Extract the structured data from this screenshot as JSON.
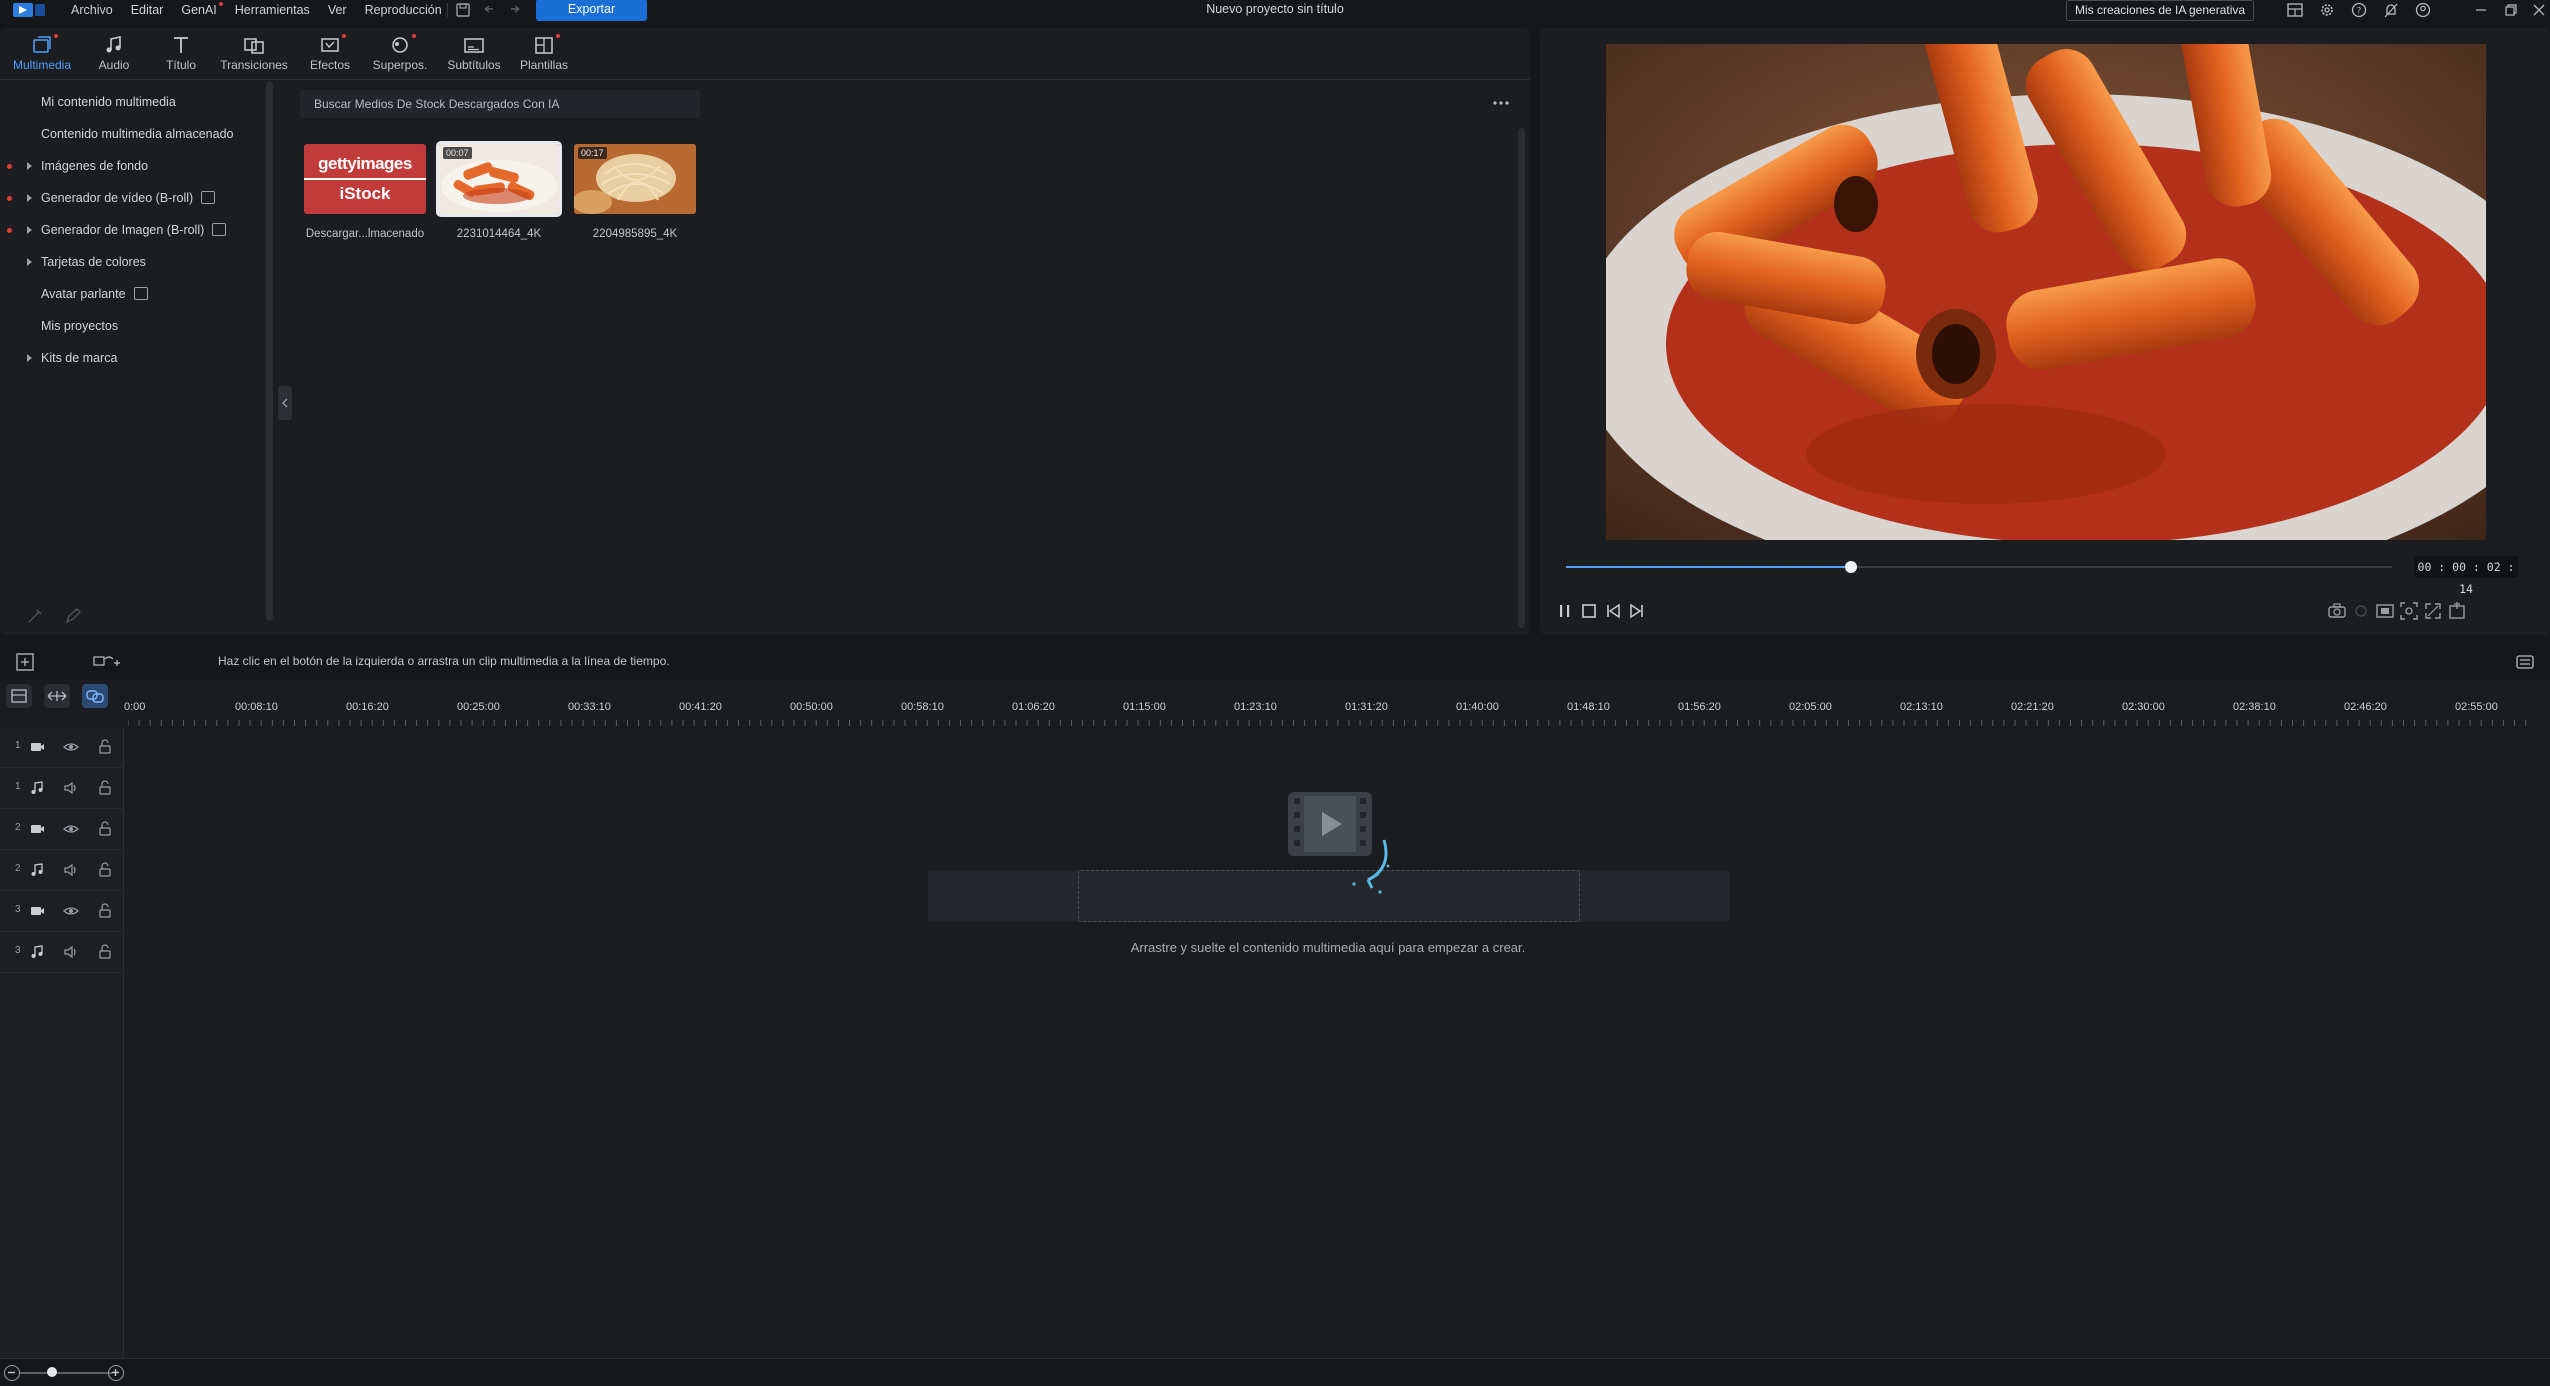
{
  "titlebar": {
    "menu": [
      {
        "label": "Archivo",
        "dot": false
      },
      {
        "label": "Editar",
        "dot": false
      },
      {
        "label": "GenAI",
        "dot": true
      },
      {
        "label": "Herramientas",
        "dot": false
      },
      {
        "label": "Ver",
        "dot": false
      },
      {
        "label": "Reproducción",
        "dot": false
      }
    ],
    "export_label": "Exportar",
    "project_title": "Nuevo proyecto sin título",
    "genai_button": "Mis creaciones de IA generativa",
    "accent": "#1a6fd6"
  },
  "ribbon": {
    "tabs": [
      {
        "label": "Multimedia",
        "icon": "media-icon",
        "active": true,
        "dot": true
      },
      {
        "label": "Audio",
        "icon": "music-note-icon",
        "active": false,
        "dot": false
      },
      {
        "label": "Título",
        "icon": "title-t-icon",
        "active": false,
        "dot": false
      },
      {
        "label": "Transiciones",
        "icon": "transition-icon",
        "active": false,
        "dot": false
      },
      {
        "label": "Efectos",
        "icon": "effects-icon",
        "active": false,
        "dot": true
      },
      {
        "label": "Superpos.",
        "icon": "overlay-icon",
        "active": false,
        "dot": true
      },
      {
        "label": "Subtítulos",
        "icon": "subtitles-icon",
        "active": false,
        "dot": false
      },
      {
        "label": "Plantillas",
        "icon": "templates-icon",
        "active": false,
        "dot": true
      }
    ]
  },
  "sidebar": {
    "items": [
      {
        "label": "Mi contenido multimedia",
        "arrow": false,
        "reddot": false,
        "badge": false
      },
      {
        "label": "Contenido multimedia almacenado",
        "arrow": false,
        "reddot": false,
        "badge": false
      },
      {
        "label": "Imágenes de fondo",
        "arrow": true,
        "reddot": true,
        "badge": false
      },
      {
        "label": "Generador de vídeo (B-roll)",
        "arrow": true,
        "reddot": true,
        "badge": true
      },
      {
        "label": "Generador de Imagen (B-roll)",
        "arrow": true,
        "reddot": true,
        "badge": true
      },
      {
        "label": "Tarjetas de colores",
        "arrow": true,
        "reddot": false,
        "badge": false
      },
      {
        "label": "Avatar parlante",
        "arrow": false,
        "reddot": false,
        "badge": true
      },
      {
        "label": "Mis proyectos",
        "arrow": false,
        "reddot": false,
        "badge": false
      },
      {
        "label": "Kits de marca",
        "arrow": true,
        "reddot": false,
        "badge": false
      }
    ]
  },
  "library": {
    "search_placeholder": "Buscar Medios De Stock Descargados Con IA",
    "media": [
      {
        "label": "Descargar...lmacenado",
        "kind": "getty",
        "brand_top": "gettyimages",
        "brand_bottom": "iStock",
        "duration": ""
      },
      {
        "label": "2231014464_4K",
        "kind": "video",
        "duration": "00:07",
        "selected": true
      },
      {
        "label": "2204985895_4K",
        "kind": "video",
        "duration": "00:17",
        "selected": false
      }
    ]
  },
  "preview": {
    "timecode": "00 : 00 : 02 : 14",
    "progress": 0.345
  },
  "timeline": {
    "hint": "Haz clic en el botón de la izquierda o arrastra un clip multimedia a la línea de tiempo.",
    "ticks": [
      "0:00",
      "00:08:10",
      "00:16:20",
      "00:25:00",
      "00:33:10",
      "00:41:20",
      "00:50:00",
      "00:58:10",
      "01:06:20",
      "01:15:00",
      "01:23:10",
      "01:31:20",
      "01:40:00",
      "01:48:10",
      "01:56:20",
      "02:05:00",
      "02:13:10",
      "02:21:20",
      "02:30:00",
      "02:38:10",
      "02:46:20",
      "02:55:00"
    ],
    "tracks": [
      {
        "num": "1",
        "type": "video"
      },
      {
        "num": "1",
        "type": "audio"
      },
      {
        "num": "2",
        "type": "video"
      },
      {
        "num": "2",
        "type": "audio"
      },
      {
        "num": "3",
        "type": "video"
      },
      {
        "num": "3",
        "type": "audio"
      }
    ],
    "drop_text": "Arrastre y suelte el contenido multimedia aquí para empezar a crear."
  },
  "zoom": {
    "level": 0.35
  }
}
